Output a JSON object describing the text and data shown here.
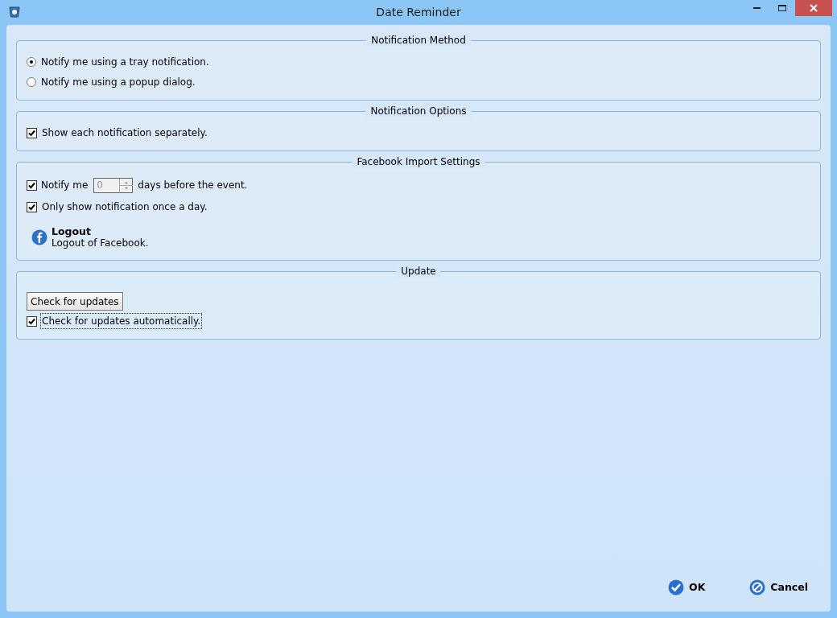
{
  "window": {
    "title": "Date Reminder"
  },
  "groups": [
    {
      "title": "Notification Method",
      "items": [
        {
          "kind": "radio",
          "label": "Notify me using a tray notification.",
          "selected": true
        },
        {
          "kind": "radio",
          "label": "Notify me using a popup dialog.",
          "selected": false
        }
      ]
    },
    {
      "title": "Notification Options",
      "items": [
        {
          "kind": "checkbox",
          "label": "Show each notification separately.",
          "checked": true,
          "focused": false
        }
      ]
    },
    {
      "title": "Facebook Import Settings",
      "items": [
        {
          "kind": "spin",
          "label": "Notify me",
          "checked": true,
          "value": "0",
          "suffix": "days before the event."
        },
        {
          "kind": "checkbox",
          "label": "Only show notification once a day.",
          "checked": true,
          "focused": false
        },
        {
          "kind": "link",
          "title": "Logout",
          "description": "Logout of Facebook."
        }
      ]
    },
    {
      "title": "Update",
      "items": [
        {
          "kind": "button",
          "label": "Check for updates"
        },
        {
          "kind": "checkbox",
          "label": "Check for updates automatically.",
          "checked": true,
          "focused": true
        }
      ]
    }
  ],
  "footer": [
    {
      "kind": "ok",
      "label": "OK"
    },
    {
      "kind": "cancel",
      "label": "Cancel"
    }
  ]
}
